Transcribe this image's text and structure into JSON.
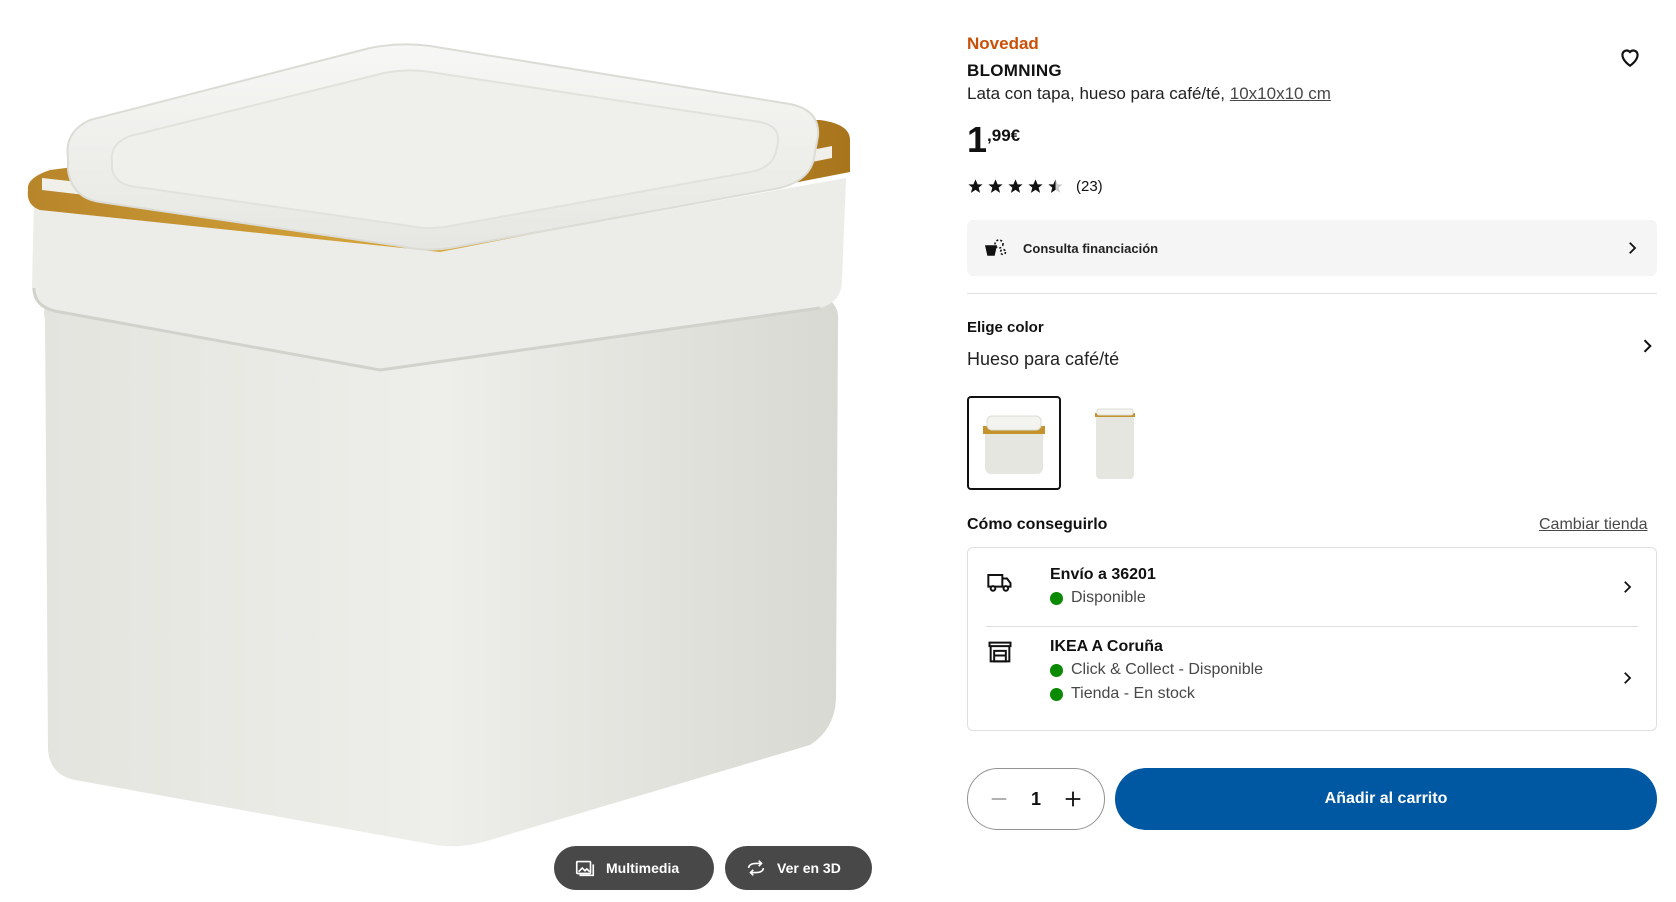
{
  "gallery": {
    "multimedia_label": "Multimedia",
    "view3d_label": "Ver en 3D"
  },
  "product": {
    "badge": "Novedad",
    "name": "BLOMNING",
    "description": "Lata con tapa, hueso para café/té,",
    "size_link": "10x10x10 cm",
    "price_int": "1",
    "price_dec": ",99€",
    "rating": 4.5,
    "reviews": "(23)"
  },
  "finance": {
    "label": "Consulta financiación"
  },
  "color": {
    "title": "Elige color",
    "value": "Hueso para café/té"
  },
  "availability": {
    "title": "Cómo conseguirlo",
    "change_store": "Cambiar tienda",
    "delivery": {
      "title": "Envío a 36201",
      "status": "Disponible"
    },
    "store": {
      "title": "IKEA A Coruña",
      "status1": "Click & Collect - Disponible",
      "status2": "Tienda - En stock"
    },
    "status_color": "#0a8a00"
  },
  "cart": {
    "quantity": "1",
    "add_label": "Añadir al carrito",
    "accent": "#0058a3"
  },
  "icons": {
    "favorite": "heart-icon",
    "finance": "finance-icon",
    "delivery": "truck-icon",
    "store": "store-icon",
    "chevron": "chevron-right-icon"
  }
}
